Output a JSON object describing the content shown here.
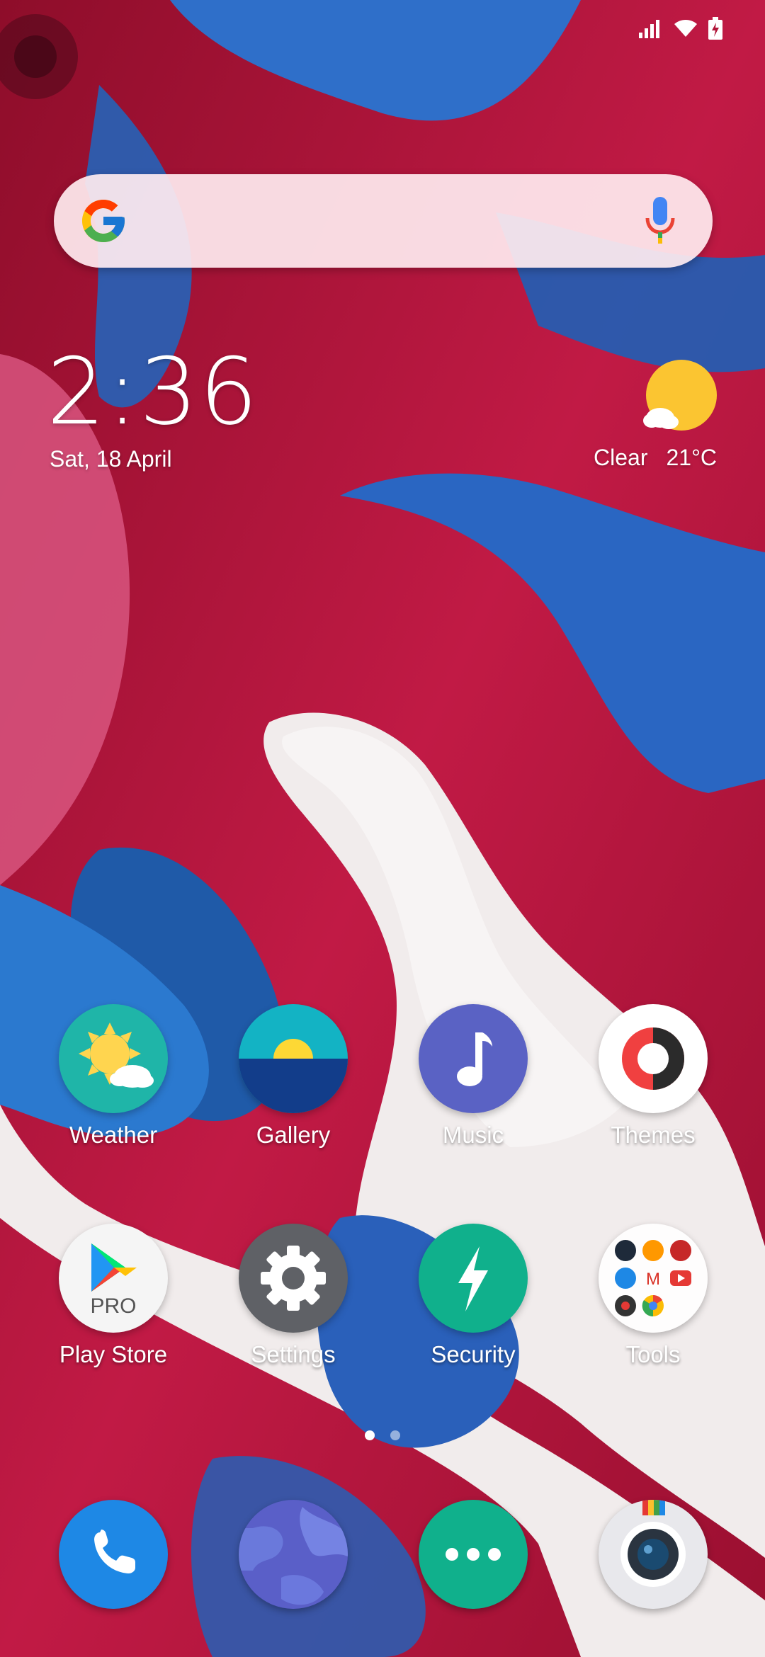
{
  "status_bar": {
    "icons": [
      "signal-icon",
      "wifi-icon",
      "battery-icon"
    ]
  },
  "search": {
    "logo": "google-g-logo",
    "voice_icon": "mic-icon"
  },
  "clock_widget": {
    "time": "2:36",
    "date": "Sat, 18 April",
    "weather_condition": "Clear",
    "temperature": "21°C"
  },
  "apps_row1": [
    {
      "label": "Weather",
      "icon": "weather-icon"
    },
    {
      "label": "Gallery",
      "icon": "gallery-icon"
    },
    {
      "label": "Music",
      "icon": "music-icon"
    },
    {
      "label": "Themes",
      "icon": "themes-icon"
    }
  ],
  "apps_row2": [
    {
      "label": "Play Store",
      "icon": "play-store-icon",
      "badge": "PRO"
    },
    {
      "label": "Settings",
      "icon": "settings-icon"
    },
    {
      "label": "Security",
      "icon": "security-icon"
    },
    {
      "label": "Tools",
      "icon": "tools-folder-icon"
    }
  ],
  "pager": {
    "pages": 2,
    "current": 1
  },
  "dock": [
    {
      "icon": "phone-icon"
    },
    {
      "icon": "browser-icon"
    },
    {
      "icon": "messaging-icon"
    },
    {
      "icon": "camera-icon"
    }
  ],
  "colors": {
    "wallpaper_red": "#b01438",
    "wallpaper_blue": "#2f6fc9",
    "security_green": "#10b08c",
    "music_purple": "#5860c0",
    "phone_blue": "#1e88e5"
  }
}
